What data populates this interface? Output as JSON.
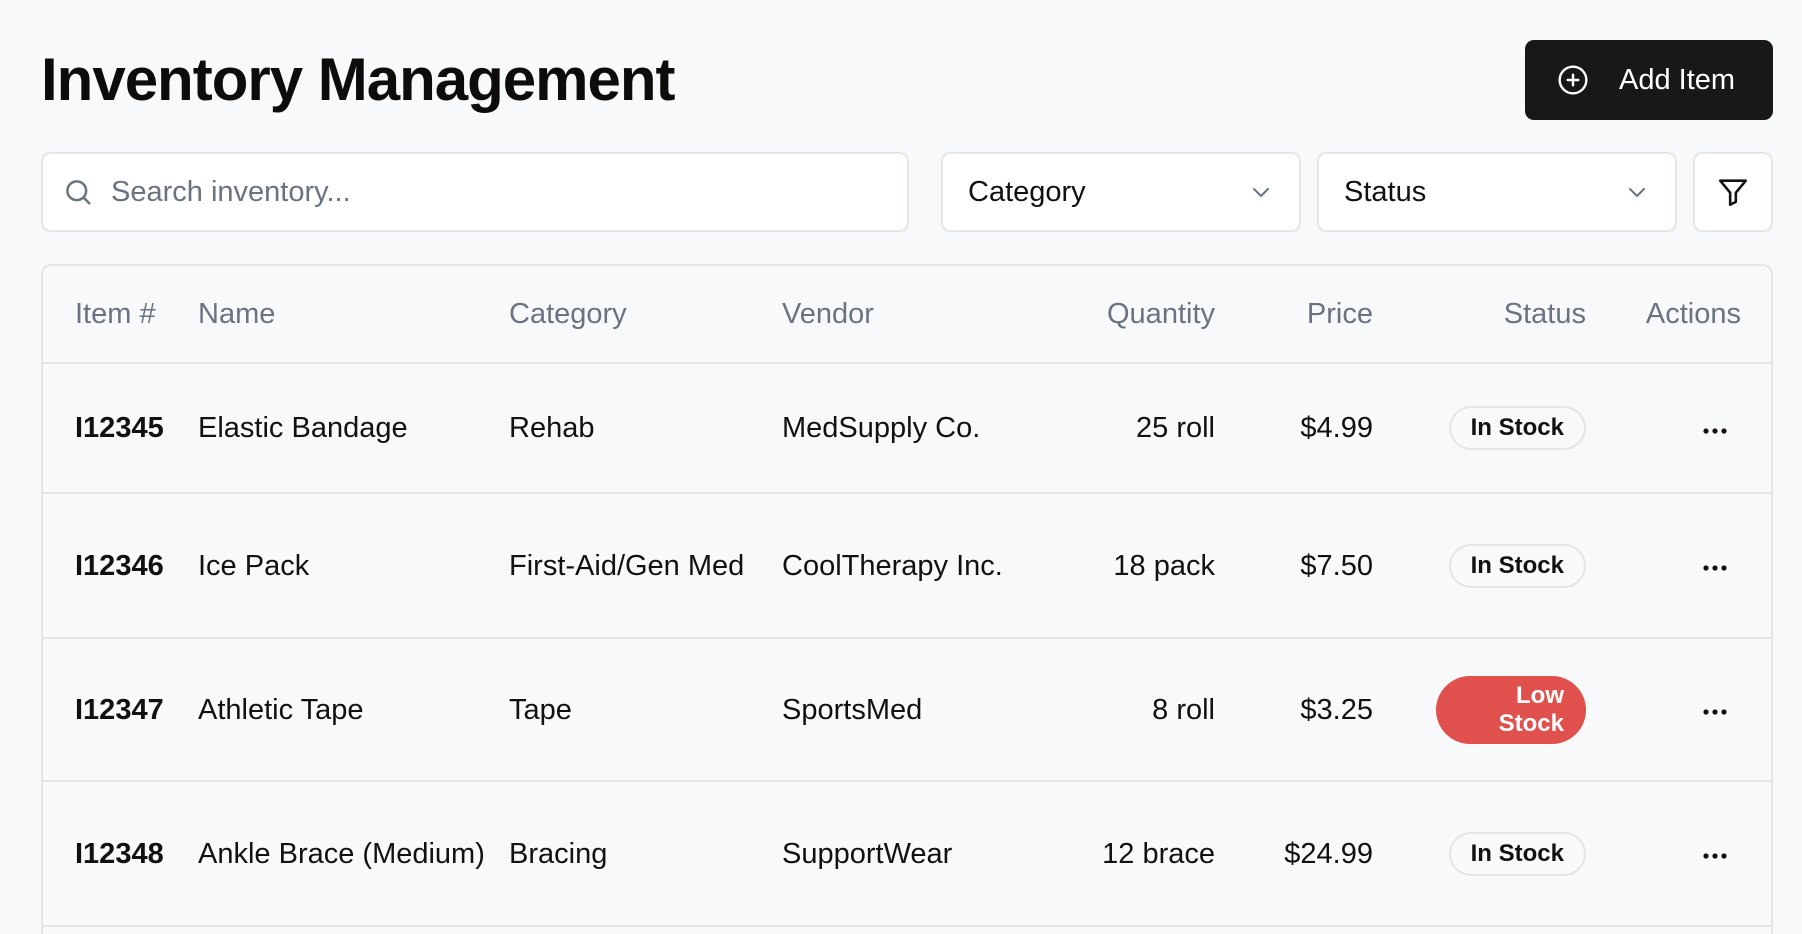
{
  "header": {
    "title": "Inventory Management",
    "add_button_label": "Add Item"
  },
  "filters": {
    "search_placeholder": "Search inventory...",
    "search_value": "",
    "category_label": "Category",
    "status_label": "Status"
  },
  "table": {
    "columns": {
      "item": "Item #",
      "name": "Name",
      "category": "Category",
      "vendor": "Vendor",
      "quantity": "Quantity",
      "price": "Price",
      "status": "Status",
      "actions": "Actions"
    },
    "rows": [
      {
        "item": "I12345",
        "name": "Elastic Bandage",
        "category": "Rehab",
        "vendor": "MedSupply Co.",
        "quantity": "25 roll",
        "price": "$4.99",
        "status": "In Stock"
      },
      {
        "item": "I12346",
        "name": "Ice Pack",
        "category": "First-Aid/Gen Med",
        "vendor": "CoolTherapy Inc.",
        "quantity": "18 pack",
        "price": "$7.50",
        "status": "In Stock"
      },
      {
        "item": "I12347",
        "name": "Athletic Tape",
        "category": "Tape",
        "vendor": "SportsMed",
        "quantity": "8 roll",
        "price": "$3.25",
        "status": "Low Stock"
      },
      {
        "item": "I12348",
        "name": "Ankle Brace (Medium)",
        "category": "Bracing",
        "vendor": "SupportWear",
        "quantity": "12 brace",
        "price": "$24.99",
        "status": "In Stock"
      }
    ]
  },
  "colors": {
    "primary_button": "#18181b",
    "low_stock": "#e0514d",
    "border": "#e3e5e9",
    "background": "#f8f9fb"
  },
  "icons": {
    "add": "plus-circle-icon",
    "search": "search-icon",
    "dropdown": "chevron-down-icon",
    "filter": "filter-icon",
    "row_actions": "more-horizontal-icon"
  }
}
